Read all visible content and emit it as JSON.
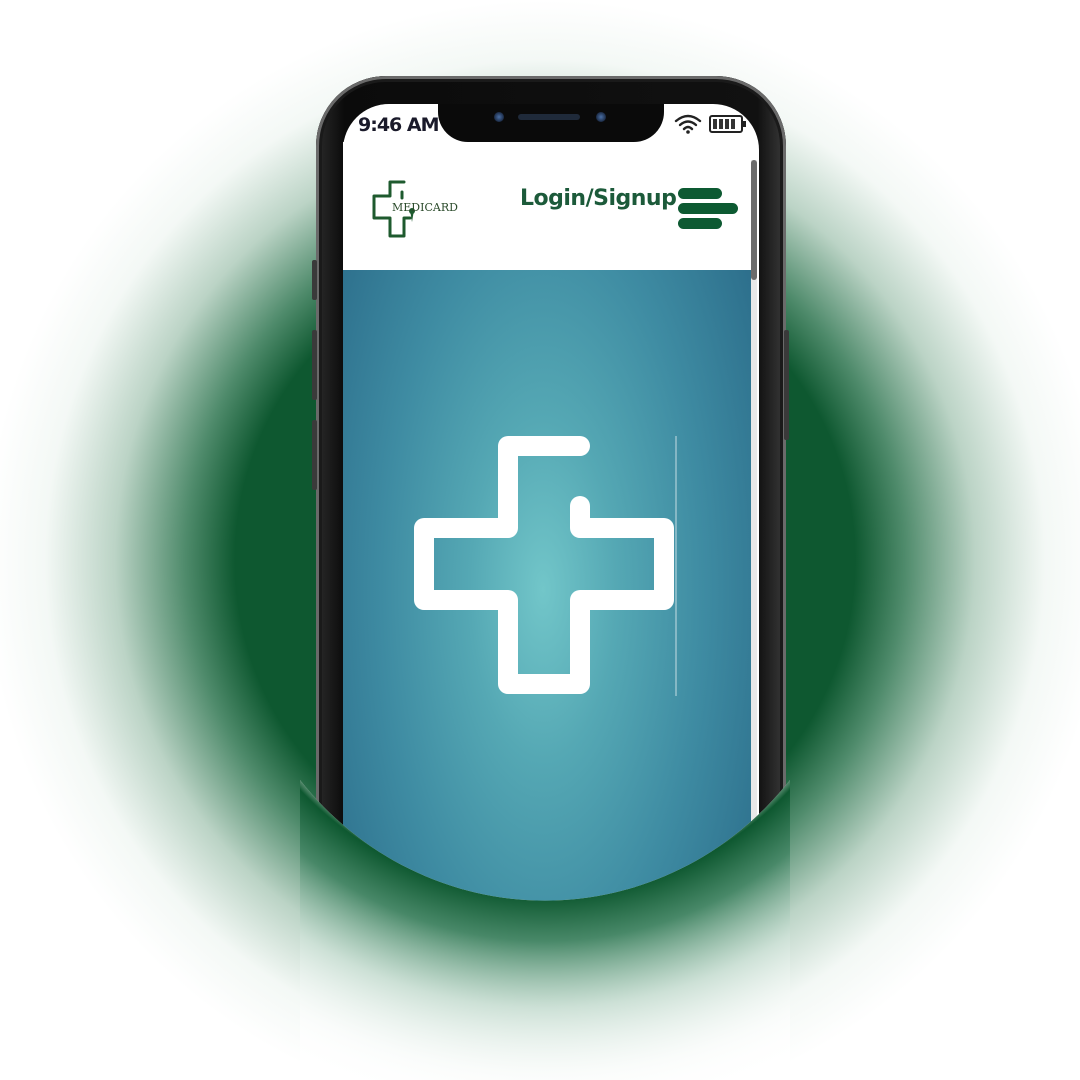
{
  "status_bar": {
    "time": "9:46 AM",
    "icons": [
      "wifi-icon",
      "battery-icon"
    ]
  },
  "header": {
    "logo_text": "MEDICARD",
    "login_label": "Login/Signup",
    "menu_icon": "hamburger-menu-icon"
  },
  "hero": {
    "icon": "medical-cross-icon"
  },
  "colors": {
    "brand_green": "#0d5a32",
    "login_text": "#1c5a3a",
    "hero_center": "#72c6c9",
    "hero_edge": "#2a6a88",
    "glow": "#0e5830"
  }
}
